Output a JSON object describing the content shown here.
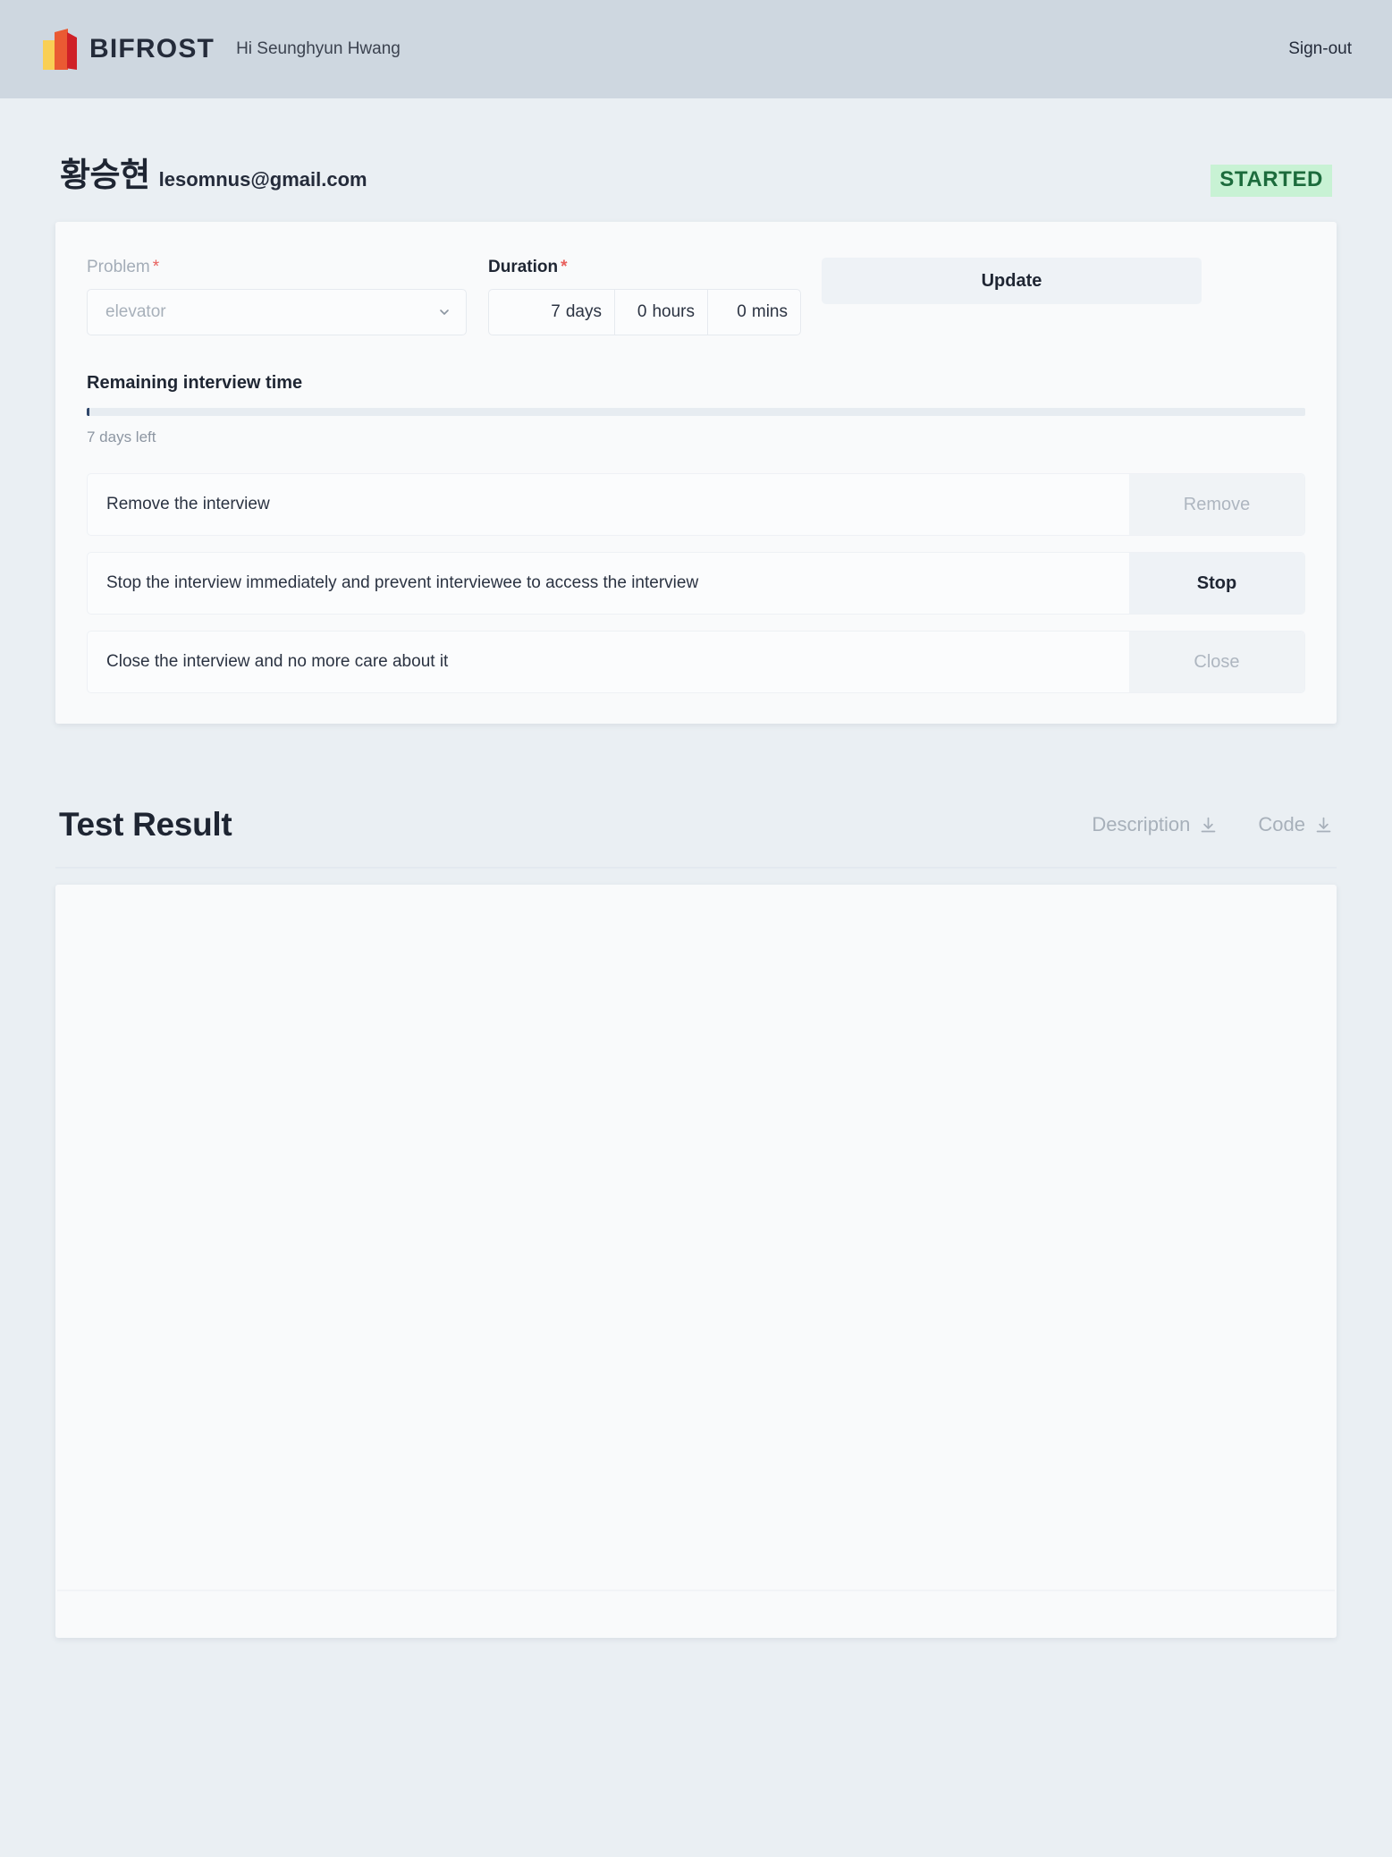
{
  "header": {
    "brand_name": "BIFROST",
    "brand_logo_icon": "bifrost-logo-icon",
    "greeting": "Hi Seunghyun Hwang",
    "signout_label": "Sign-out"
  },
  "identity": {
    "name": "황승현",
    "email": "lesomnus@gmail.com",
    "status": "STARTED",
    "status_bg": "#c8f2d4",
    "status_color": "#1c6b3c"
  },
  "form": {
    "problem": {
      "label": "Problem",
      "required_mark": "*",
      "value": "elevator",
      "chevron_icon": "chevron-down-icon"
    },
    "duration": {
      "label": "Duration",
      "required_mark": "*",
      "days_value": "7",
      "days_unit": "days",
      "hours_value": "0",
      "hours_unit": "hours",
      "mins_value": "0",
      "mins_unit": "mins"
    },
    "update_label": "Update"
  },
  "progress": {
    "title": "Remaining interview time",
    "note": "7 days left",
    "percent": 0.2,
    "fill_color": "#30476b",
    "track_color": "#e7ecf1"
  },
  "actions": [
    {
      "text": "Remove the interview",
      "button_label": "Remove",
      "disabled": true
    },
    {
      "text": "Stop the interview immediately and prevent interviewee to access the interview",
      "button_label": "Stop",
      "disabled": false
    },
    {
      "text": "Close the interview and no more care about it",
      "button_label": "Close",
      "disabled": true
    }
  ],
  "result": {
    "title": "Test Result",
    "description_label": "Description",
    "code_label": "Code",
    "download_icon": "download-icon",
    "body_text": ""
  }
}
